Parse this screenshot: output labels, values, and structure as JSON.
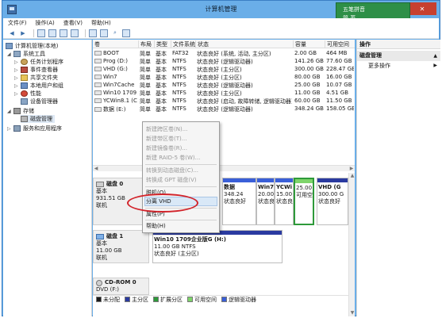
{
  "window": {
    "title": "计算机管理"
  },
  "window_controls": {
    "min": "—",
    "max": "☐",
    "close": "✕"
  },
  "ime": {
    "line1": "五笔拼音",
    "line2": "简 英"
  },
  "menu": [
    "文件(F)",
    "操作(A)",
    "查看(V)",
    "帮助(H)"
  ],
  "tree": {
    "root": "计算机管理(本地)",
    "system_tools": "系统工具",
    "task_scheduler": "任务计划程序",
    "event_viewer": "事件查看器",
    "shared_folders": "共享文件夹",
    "local_users": "本地用户和组",
    "performance": "性能",
    "device_manager": "设备管理器",
    "storage": "存储",
    "disk_management": "磁盘管理",
    "services": "服务和应用程序"
  },
  "columns": [
    "卷",
    "布局",
    "类型",
    "文件系统",
    "状态",
    "容量",
    "可用空间"
  ],
  "volumes": [
    [
      "BOOT",
      "简单",
      "基本",
      "FAT32",
      "状态良好 (系统, 活动, 主分区)",
      "2.00 GB",
      "464 MB"
    ],
    [
      "Prog (D:)",
      "简单",
      "基本",
      "NTFS",
      "状态良好 (逻辑驱动器)",
      "141.26 GB",
      "77.60 GB"
    ],
    [
      "VHD (G:)",
      "简单",
      "基本",
      "NTFS",
      "状态良好 (主分区)",
      "300.00 GB",
      "228.47 GB"
    ],
    [
      "Win7",
      "简单",
      "基本",
      "NTFS",
      "状态良好 (主分区)",
      "80.00 GB",
      "16.00 GB"
    ],
    [
      "Win7Cache",
      "简单",
      "基本",
      "NTFS",
      "状态良好 (逻辑驱动器)",
      "25.00 GB",
      "10.07 GB"
    ],
    [
      "Win10 1709…",
      "简单",
      "基本",
      "NTFS",
      "状态良好 (主分区)",
      "11.00 GB",
      "4.51 GB"
    ],
    [
      "YCWin8.1 (C:)",
      "简单",
      "基本",
      "NTFS",
      "状态良好 (启动, 故障转储, 逻辑驱动器)",
      "60.00 GB",
      "11.50 GB"
    ],
    [
      "数据 (E:)",
      "简单",
      "基本",
      "NTFS",
      "状态良好 (逻辑驱动器)",
      "348.24 GB",
      "158.05 GB"
    ]
  ],
  "disk0": {
    "name": "磁盘 0",
    "type": "基本",
    "size": "931.51 GB",
    "status": "联机",
    "partitions": [
      {
        "name": "数据",
        "size": "348.24",
        "status": "状态良好"
      },
      {
        "name": "Win7",
        "size": "20.00",
        "status": "状态良好"
      },
      {
        "name": "YCWi",
        "size": "15.00",
        "status": "状态良好"
      },
      {
        "name": "",
        "size": "25.00",
        "status": "可用空"
      },
      {
        "name": "VHD (G",
        "size": "300.00 G",
        "status": "状态良好"
      }
    ]
  },
  "disk1": {
    "name": "磁盘 1",
    "type": "基本",
    "size": "11.00 GB",
    "status": "联机",
    "partition": {
      "name": "Win10 1709企业版G (H:)",
      "size": "11.00 GB NTFS",
      "status": "状态良好 (主分区)"
    }
  },
  "cdrom": {
    "name": "CD-ROM 0",
    "type": "DVD (F:)"
  },
  "legend": [
    "未分配",
    "主分区",
    "扩展分区",
    "可用空间",
    "逻辑驱动器"
  ],
  "colors": {
    "unallocated": "#1a1a1a",
    "primary": "#2a3aa0",
    "extended": "#2e9a3a",
    "free": "#7ed46a",
    "logical": "#3a5fd8",
    "highlight_oval": "#d2232a"
  },
  "actions": {
    "header": "操作",
    "selected": "磁盘管理",
    "more": "更多操作"
  },
  "context_menu": {
    "items": [
      {
        "label": "新建跨区卷(N)...",
        "enabled": false
      },
      {
        "label": "新建带区卷(T)...",
        "enabled": false
      },
      {
        "label": "新建镜像卷(R)...",
        "enabled": false
      },
      {
        "label": "新建 RAID-5 卷(W)...",
        "enabled": false
      },
      {
        "label": "转换到动态磁盘(C)...",
        "enabled": false
      },
      {
        "label": "转换成 GPT 磁盘(V)",
        "enabled": false
      },
      {
        "label": "脱机(O)",
        "enabled": true
      },
      {
        "label": "分离 VHD",
        "enabled": true
      },
      {
        "label": "属性(P)",
        "enabled": true
      },
      {
        "label": "帮助(H)",
        "enabled": true
      }
    ]
  }
}
